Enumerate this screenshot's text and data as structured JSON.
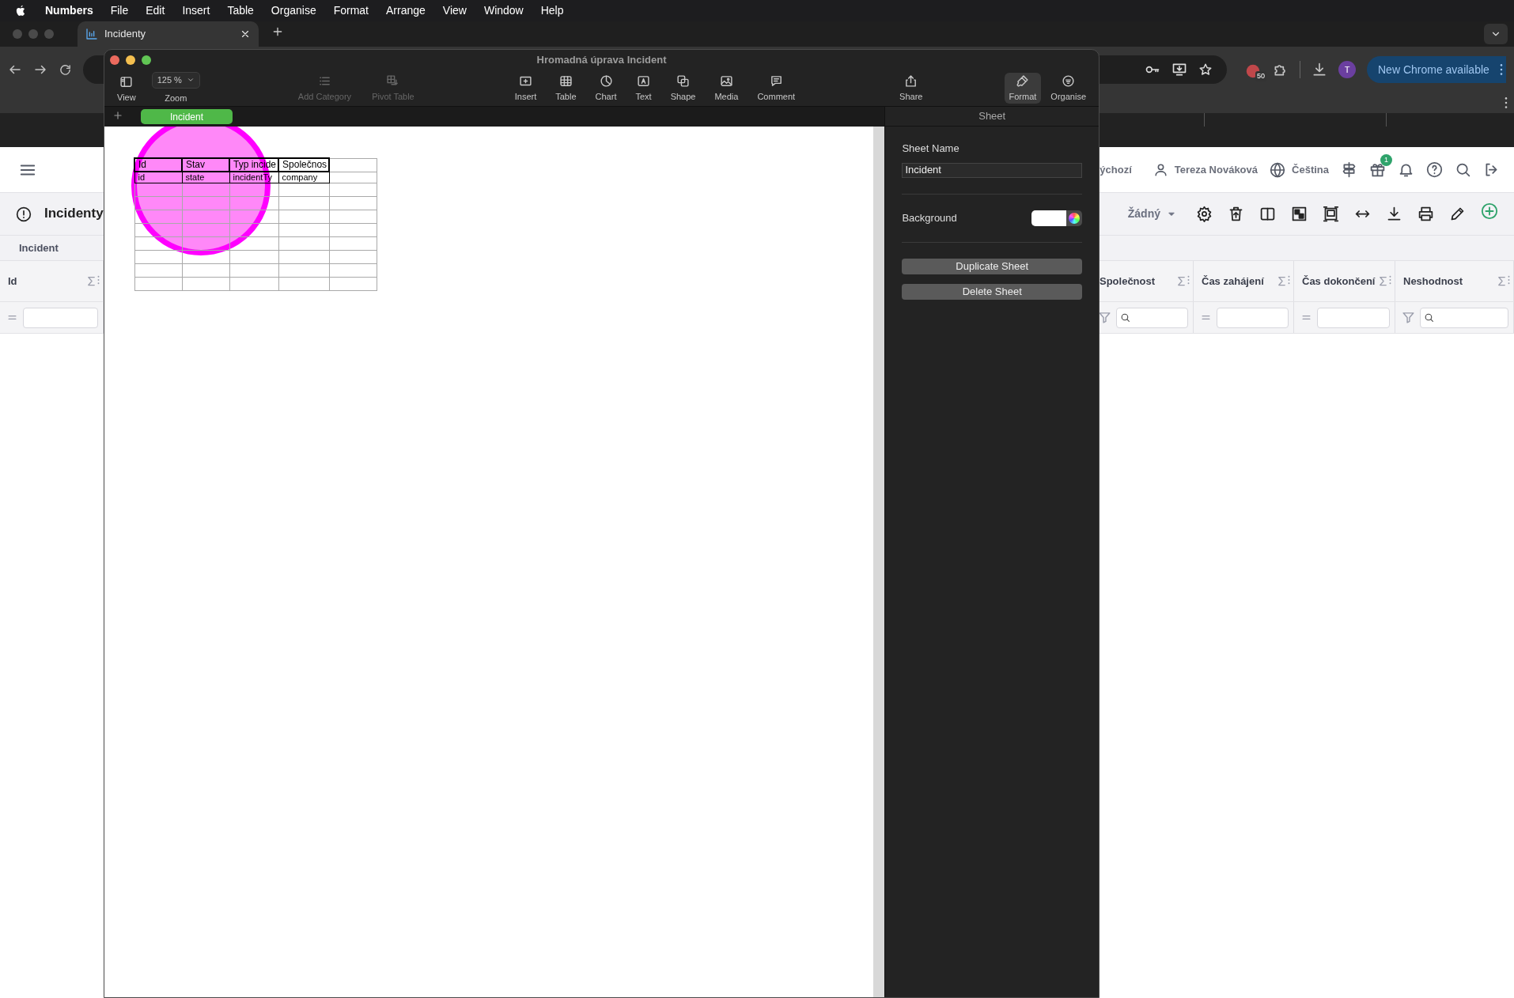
{
  "menu_bar": {
    "app_name": "Numbers",
    "items": [
      "File",
      "Edit",
      "Insert",
      "Table",
      "Organise",
      "Format",
      "Arrange",
      "View",
      "Window",
      "Help"
    ]
  },
  "browser": {
    "tabs": [
      {
        "title": "Incidenty",
        "selected": true
      }
    ],
    "extension_badge": "50",
    "profile_initial": "T",
    "update_button": "New Chrome available"
  },
  "web_page": {
    "header": {
      "cut_link": "ýchozí",
      "user_name": "Tereza Nováková",
      "language": "Čeština",
      "gift_badge": "1"
    },
    "title": "Incidenty",
    "view_select": "Žádný",
    "tabs": [
      {
        "label": "Incident"
      }
    ],
    "columns_left": [
      {
        "label": "Id",
        "kind": "equals"
      }
    ],
    "columns_right": [
      {
        "label": "Společnost",
        "kind": "search"
      },
      {
        "label": "Čas zahájení",
        "kind": "equals"
      },
      {
        "label": "Čas dokončení",
        "kind": "equals"
      },
      {
        "label": "Neshodnost",
        "kind": "search"
      }
    ]
  },
  "numbers_window": {
    "title": "Hromadná úprava Incident",
    "toolbar": [
      [
        {
          "kind": "view",
          "label": "View",
          "disabled": false,
          "selected": false
        },
        {
          "kind": "zoom",
          "label": "Zoom",
          "value": "125 %",
          "disabled": false,
          "selected": false
        }
      ],
      [
        {
          "kind": "add_category",
          "label": "Add Category",
          "disabled": true,
          "selected": false
        },
        {
          "kind": "pivot_table",
          "label": "Pivot Table",
          "disabled": true,
          "selected": false
        }
      ],
      [
        {
          "kind": "insert",
          "label": "Insert",
          "disabled": false,
          "selected": false
        },
        {
          "kind": "table",
          "label": "Table",
          "disabled": false,
          "selected": false
        },
        {
          "kind": "chart",
          "label": "Chart",
          "disabled": false,
          "selected": false
        },
        {
          "kind": "text",
          "label": "Text",
          "disabled": false,
          "selected": false
        },
        {
          "kind": "shape",
          "label": "Shape",
          "disabled": false,
          "selected": false
        },
        {
          "kind": "media",
          "label": "Media",
          "disabled": false,
          "selected": false
        },
        {
          "kind": "comment",
          "label": "Comment",
          "disabled": false,
          "selected": false
        }
      ],
      [
        {
          "kind": "share",
          "label": "Share",
          "disabled": false,
          "selected": false
        }
      ],
      [
        {
          "kind": "format",
          "label": "Format",
          "disabled": false,
          "selected": true
        },
        {
          "kind": "organise",
          "label": "Organise",
          "disabled": false,
          "selected": false
        }
      ]
    ],
    "sheet_tabs": [
      {
        "label": "Incident",
        "selected": true
      }
    ],
    "table": {
      "rows": [
        [
          "Id",
          "Stav",
          "Typ incide",
          "Společnos"
        ],
        [
          "id",
          "state",
          "incidentTy",
          "company"
        ]
      ]
    },
    "inspector": {
      "title": "Sheet",
      "sheet_name_label": "Sheet Name",
      "sheet_name": "Incident",
      "background_label": "Background",
      "buttons": [
        "Duplicate Sheet",
        "Delete Sheet"
      ]
    }
  }
}
